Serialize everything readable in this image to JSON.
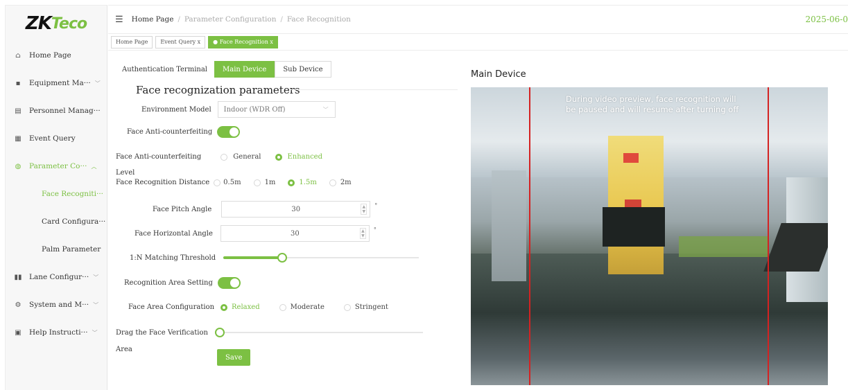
{
  "logo": {
    "text_main": "ZK",
    "text_accent": "Teco"
  },
  "sidebar": {
    "items": [
      {
        "label": "Home Page",
        "icon": "home-icon",
        "expandable": false
      },
      {
        "label": "Equipment Ma···",
        "icon": "equipment-icon",
        "expandable": true
      },
      {
        "label": "Personnel Manag···",
        "icon": "personnel-icon",
        "expandable": false
      },
      {
        "label": "Event Query",
        "icon": "event-icon",
        "expandable": false
      },
      {
        "label": "Parameter Co···",
        "icon": "parameter-icon",
        "expandable": true,
        "expanded": true,
        "children": [
          {
            "label": "Face Recogniti···",
            "active": true
          },
          {
            "label": "Card Configura···"
          },
          {
            "label": "Palm Parameter"
          }
        ]
      },
      {
        "label": "Lane Configur···",
        "icon": "lane-icon",
        "expandable": true
      },
      {
        "label": "System and M···",
        "icon": "system-icon",
        "expandable": true
      },
      {
        "label": "Help Instructi···",
        "icon": "help-icon",
        "expandable": true
      }
    ]
  },
  "header": {
    "breadcrumb": [
      "Home Page",
      "Parameter Configuration",
      "Face Recognition"
    ],
    "date": "2025-06-0"
  },
  "tabs": [
    {
      "label": "Home Page"
    },
    {
      "label": "Event Query x"
    },
    {
      "label": "● Face Recognition x",
      "active": true
    }
  ],
  "form": {
    "auth_terminal_label": "Authentication Terminal",
    "auth_options": [
      "Main Device",
      "Sub Device"
    ],
    "auth_selected": "Main Device",
    "section_title": "Face recognization parameters",
    "env_model_label": "Environment Model",
    "env_model_value": "Indoor (WDR Off)",
    "anti_counterfeit_label": "Face Anti-counterfeiting",
    "anti_counterfeit_on": true,
    "anti_level_label_1": "Face Anti-counterfeiting",
    "anti_level_label_2": "Level",
    "anti_level_options": [
      "General",
      "Enhanced"
    ],
    "anti_level_selected": "Enhanced",
    "distance_label": "Face Recognition Distance",
    "distance_options": [
      "0.5m",
      "1m",
      "1.5m",
      "2m"
    ],
    "distance_selected": "1.5m",
    "pitch_label": "Face Pitch Angle",
    "pitch_value": "30",
    "horizontal_label": "Face Horizontal Angle",
    "horizontal_value": "30",
    "degree_symbol": "°",
    "threshold_label": "1:N Matching Threshold",
    "threshold_fraction": 0.29,
    "recog_area_label": "Recognition Area Setting",
    "recog_area_on": true,
    "face_area_label": "Face Area Configuration",
    "face_area_options": [
      "Relaxed",
      "Moderate",
      "Stringent"
    ],
    "face_area_selected": "Relaxed",
    "drag_label_1": "Drag the Face Verification",
    "drag_label_2": "Area",
    "drag_fraction": 0.0,
    "save_label": "Save"
  },
  "video": {
    "title": "Main Device",
    "note": "During video preview, face recognition will be paused and will resume after turning off"
  },
  "colors": {
    "accent": "#7cc043",
    "guide_line": "#d42222"
  }
}
